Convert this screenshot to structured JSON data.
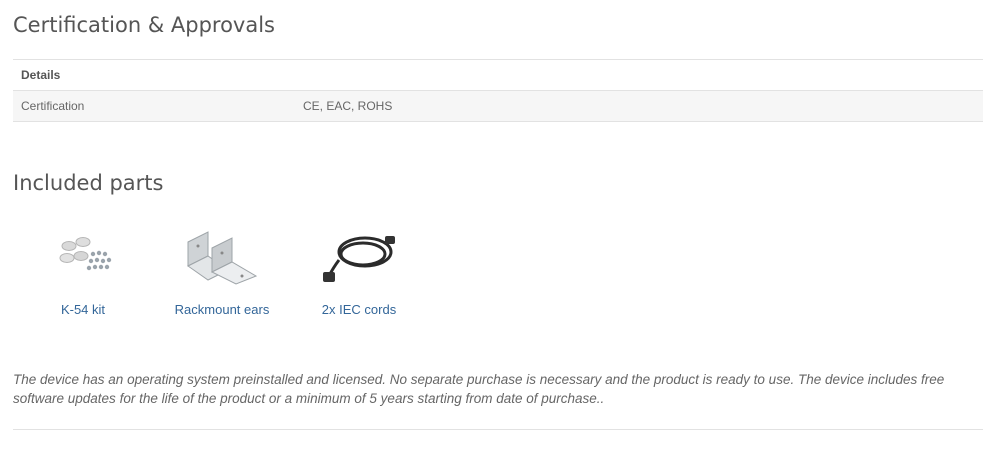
{
  "certification_section": {
    "title": "Certification & Approvals",
    "table": {
      "header": "Details",
      "rows": [
        {
          "label": "Certification",
          "value": "CE, EAC, ROHS"
        }
      ]
    }
  },
  "included_parts_section": {
    "title": "Included parts",
    "items": [
      {
        "label": "K-54 kit",
        "icon": "screw-kit-icon"
      },
      {
        "label": "Rackmount ears",
        "icon": "rackmount-ears-icon"
      },
      {
        "label": "2x IEC cords",
        "icon": "power-cord-icon"
      }
    ]
  },
  "note": "The device has an operating system preinstalled and licensed. No separate purchase is necessary and the product is ready to use. The device includes free software updates for the life of the product or a minimum of 5 years starting from date of purchase..",
  "colors": {
    "link": "#336699",
    "text": "#555555",
    "row_bg": "#f6f6f6",
    "border": "#e2e2e2"
  }
}
